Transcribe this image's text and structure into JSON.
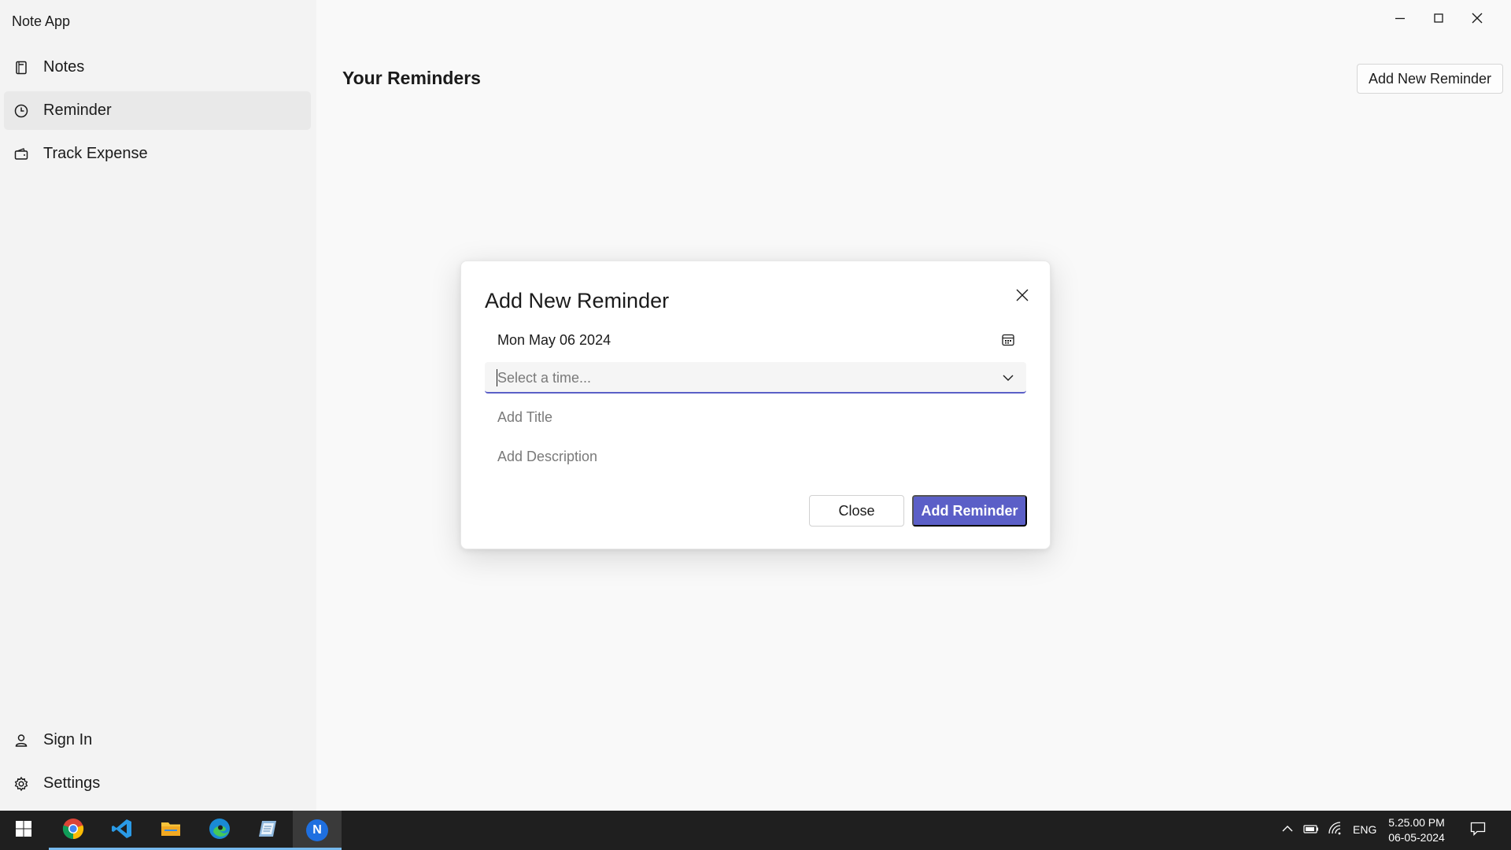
{
  "app": {
    "title": "Note App"
  },
  "sidebar": {
    "items": [
      {
        "label": "Notes",
        "icon": "notebook-icon",
        "active": false
      },
      {
        "label": "Reminder",
        "icon": "clock-icon",
        "active": true
      },
      {
        "label": "Track Expense",
        "icon": "wallet-icon",
        "active": false
      }
    ],
    "footer_items": [
      {
        "label": "Sign In",
        "icon": "person-icon"
      },
      {
        "label": "Settings",
        "icon": "gear-icon"
      }
    ]
  },
  "window_controls": [
    "minimize-icon",
    "maximize-icon",
    "close-icon"
  ],
  "main": {
    "title": "Your Reminders",
    "add_button_label": "Add New Reminder"
  },
  "dialog": {
    "title": "Add New Reminder",
    "date_value": "Mon May 06 2024",
    "time_placeholder": "Select a time...",
    "title_placeholder": "Add Title",
    "description_placeholder": "Add Description",
    "close_label": "Close",
    "submit_label": "Add Reminder"
  },
  "taskbar": {
    "apps": [
      "windows-start-icon",
      "chrome-icon",
      "vscode-icon",
      "file-explorer-icon",
      "edge-icon",
      "notepad-icon",
      "note-app-icon"
    ],
    "active_app_letter": "N",
    "language": "ENG",
    "time": "5.25.00 PM",
    "date": "06-05-2024"
  },
  "colors": {
    "accent": "#5b5fc7",
    "sidebar_bg": "#f3f3f3",
    "content_bg": "#f9f9f9",
    "taskbar_bg": "#1f1f1f"
  }
}
